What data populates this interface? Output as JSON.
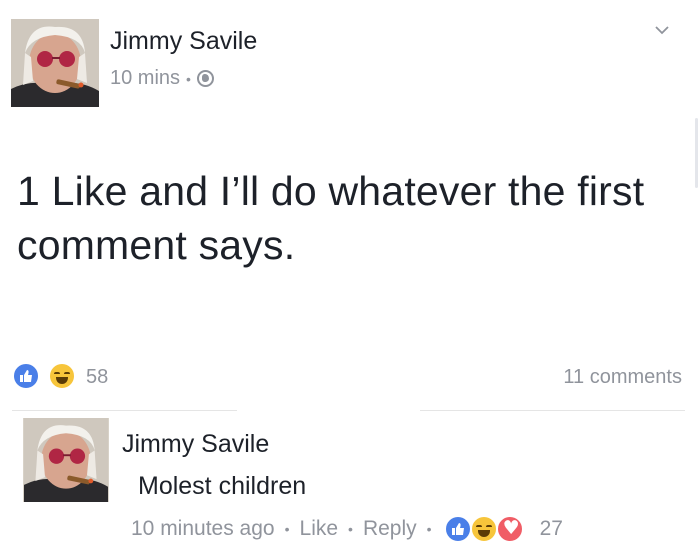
{
  "post": {
    "author": "Jimmy Savile",
    "time": "10 mins",
    "privacy_icon": "globe-icon",
    "text": "1 Like and I’ll do whatever the first comment says.",
    "reactions": [
      "like",
      "haha"
    ],
    "reaction_count": "58",
    "comment_count": "11 comments"
  },
  "comment": {
    "author": "Jimmy Savile",
    "text": "Molest children",
    "time": "10 minutes ago",
    "like_label": "Like",
    "reply_label": "Reply",
    "reactions": [
      "like",
      "haha",
      "love"
    ],
    "reaction_count": "27"
  },
  "colors": {
    "like_blue": "#4a7fe8",
    "haha_yellow": "#f7c53b",
    "love_red": "#f05d66",
    "meta_gray": "#90949c"
  }
}
